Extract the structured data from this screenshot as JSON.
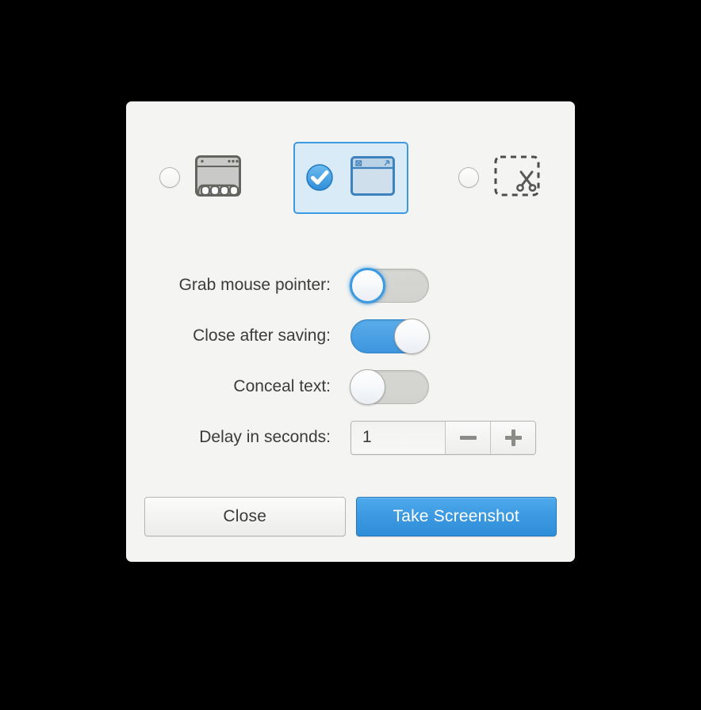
{
  "dialog": {
    "background_color": "#f4f4f2",
    "backdrop_color": "#000000"
  },
  "mode_selector": {
    "name": "screenshot-area-mode",
    "selected_index": 1,
    "options": [
      {
        "id": "grab-whole-screen",
        "icon": "desktop-screen-icon",
        "selected": "false",
        "radio_state": "unchecked"
      },
      {
        "id": "grab-current-window",
        "icon": "window-icon",
        "selected": "true",
        "radio_state": "checked"
      },
      {
        "id": "select-area-to-grab",
        "icon": "scissors-selection-icon",
        "selected": "false",
        "radio_state": "unchecked"
      }
    ]
  },
  "options": {
    "grab_pointer": {
      "label": "Grab mouse pointer:",
      "state": "off",
      "focused": "true"
    },
    "close_after_saving": {
      "label": "Close after saving:",
      "state": "on",
      "focused": "false"
    },
    "conceal_text": {
      "label": "Conceal text:",
      "state": "off",
      "focused": "false"
    },
    "delay": {
      "label": "Delay in seconds:",
      "value": "1",
      "decrement_label": "−",
      "increment_label": "+"
    }
  },
  "footer": {
    "close_label": "Close",
    "take_screenshot_label": "Take Screenshot",
    "suggested_color": "#3c99e0"
  }
}
